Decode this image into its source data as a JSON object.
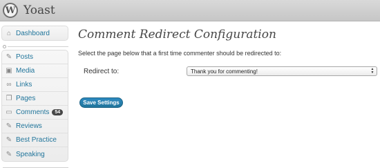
{
  "header": {
    "site_title": "Yoast",
    "logo_letter": "W"
  },
  "sidebar": {
    "top_items": [
      {
        "label": "Dashboard",
        "icon": "dashboard-icon"
      }
    ],
    "items": [
      {
        "label": "Posts",
        "icon": "pushpin-icon"
      },
      {
        "label": "Media",
        "icon": "media-icon"
      },
      {
        "label": "Links",
        "icon": "link-icon"
      },
      {
        "label": "Pages",
        "icon": "pages-icon"
      },
      {
        "label": "Comments",
        "icon": "comment-icon",
        "badge": "54"
      },
      {
        "label": "Reviews",
        "icon": "pushpin-icon"
      },
      {
        "label": "Best Practice",
        "icon": "pushpin-icon"
      },
      {
        "label": "Speaking",
        "icon": "pushpin-icon"
      }
    ]
  },
  "main": {
    "title": "Comment Redirect Configuration",
    "description": "Select the page below that a first time commenter should be redirected to:",
    "redirect_label": "Redirect to:",
    "redirect_value": "Thank you for commenting!",
    "save_label": "Save Settings"
  },
  "colors": {
    "link": "#21759b",
    "button": "#21759b",
    "header_bg": "#cfcfcf"
  }
}
